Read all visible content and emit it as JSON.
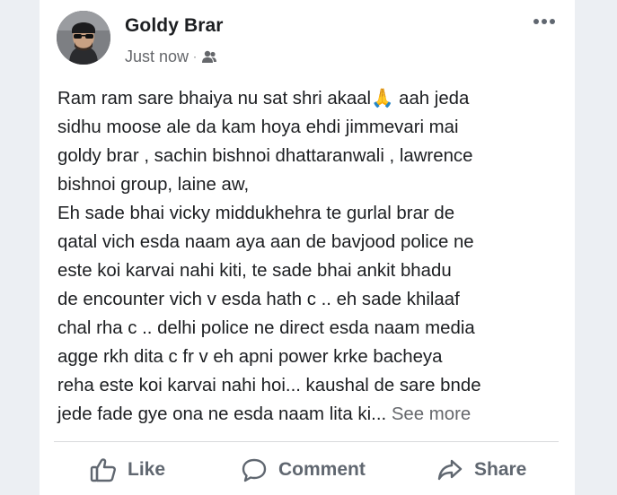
{
  "post": {
    "author": "Goldy Brar",
    "timestamp": "Just now",
    "separator": "·",
    "audience_icon": "friends-icon",
    "menu_icon": "more-horizontal-icon",
    "text": "Ram ram sare bhaiya nu sat shri akaal🙏 aah jeda\nsidhu moose ale da kam hoya ehdi jimmevari mai\ngoldy brar , sachin bishnoi dhattaranwali , lawrence\nbishnoi group,  laine aw,\nEh sade bhai vicky middukhehra te gurlal brar de\nqatal vich esda naam aya aan de bavjood police ne\neste koi karvai nahi kiti, te sade bhai ankit bhadu\nde encounter vich v esda hath c .. eh sade khilaaf\nchal rha c .. delhi police ne direct esda naam media\nagge rkh dita c fr v eh apni power krke bacheya\nreha este koi karvai nahi hoi... kaushal de sare bnde\njede fade gye ona ne esda naam lita ki... ",
    "see_more": "See more"
  },
  "actions": {
    "like": "Like",
    "comment": "Comment",
    "share": "Share"
  },
  "colors": {
    "background": "#eceff3",
    "card": "#ffffff",
    "text": "#1c1e21",
    "secondary": "#65676b",
    "action": "#606770"
  }
}
